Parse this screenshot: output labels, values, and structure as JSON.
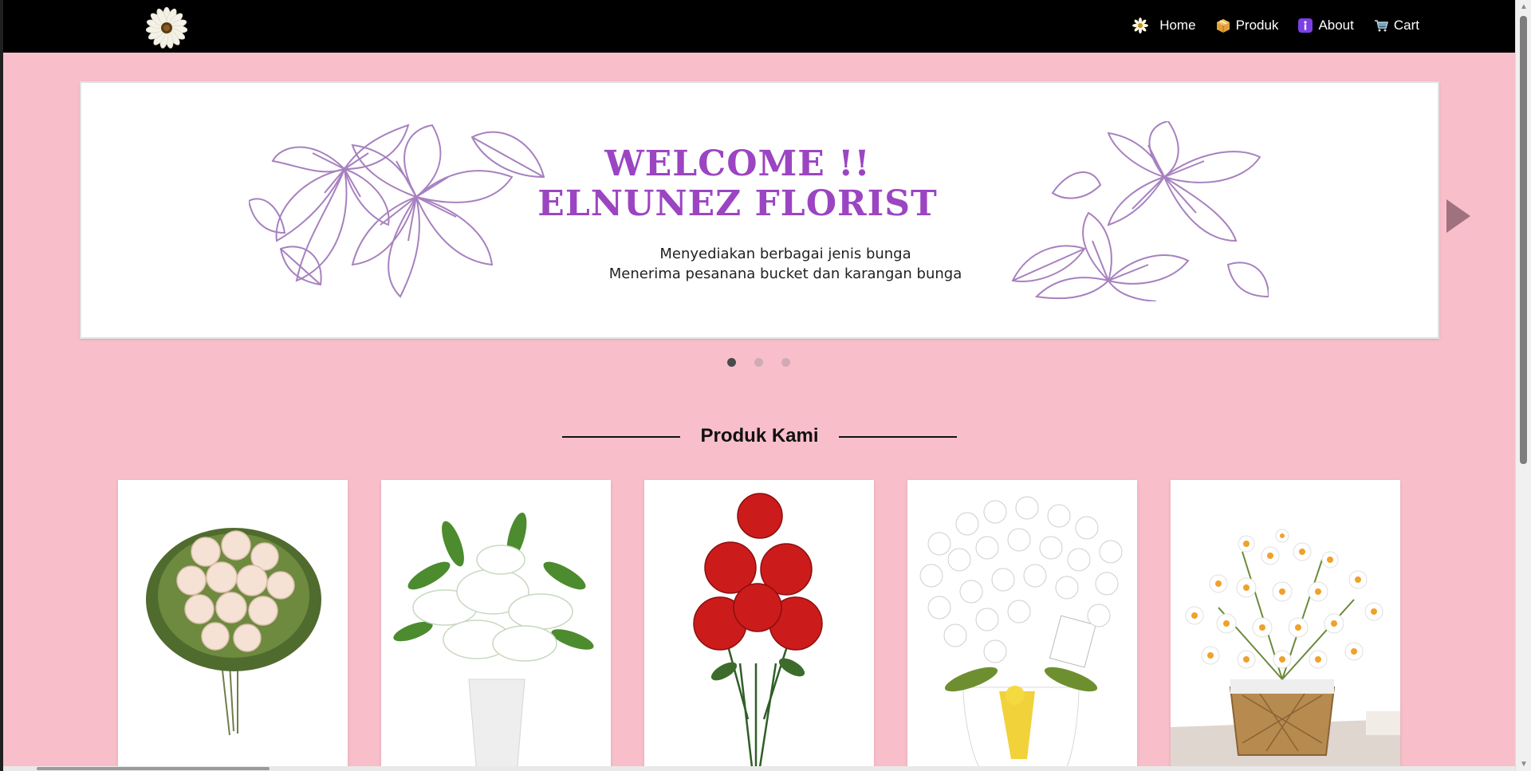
{
  "navbar": {
    "logo": "daisy-logo",
    "links": [
      {
        "label": "Home",
        "icon": "daisy-icon"
      },
      {
        "label": "Produk",
        "icon": "package-icon"
      },
      {
        "label": "About",
        "icon": "info-icon"
      },
      {
        "label": "Cart",
        "icon": "cart-icon"
      }
    ]
  },
  "hero": {
    "title_line1": "WELCOME !!",
    "title_line2": "ELNUNEZ FLORIST",
    "subtitle_line1": "Menyediakan berbagai jenis bunga",
    "subtitle_line2": "Menerima pesanana bucket dan karangan bunga",
    "slides_total": 3,
    "active_slide": 1
  },
  "products_section": {
    "title": "Produk Kami",
    "items": [
      {
        "image": "white-rose-bouquet"
      },
      {
        "image": "white-lily-bouquet"
      },
      {
        "image": "red-peony-bunch"
      },
      {
        "image": "white-orchid-vase"
      },
      {
        "image": "daisy-basket"
      }
    ]
  },
  "colors": {
    "background": "#f8bfcb",
    "navbar": "#000000",
    "accent_purple": "#9b45c2",
    "floral_outline": "#a781bf"
  }
}
